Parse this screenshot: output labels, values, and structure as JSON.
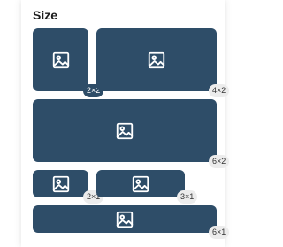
{
  "panel": {
    "title": "Size"
  },
  "tiles": [
    {
      "label": "2×2",
      "icon": "image-icon"
    },
    {
      "label": "4×2",
      "icon": "image-icon"
    },
    {
      "label": "6×2",
      "icon": "image-icon"
    },
    {
      "label": "2×1",
      "icon": "image-icon"
    },
    {
      "label": "3×1",
      "icon": "image-icon"
    },
    {
      "label": "6×1",
      "icon": "image-icon"
    }
  ],
  "colors": {
    "tile": "#2e4d68",
    "badge_light": "#ececec",
    "title": "#1d1d1d"
  }
}
